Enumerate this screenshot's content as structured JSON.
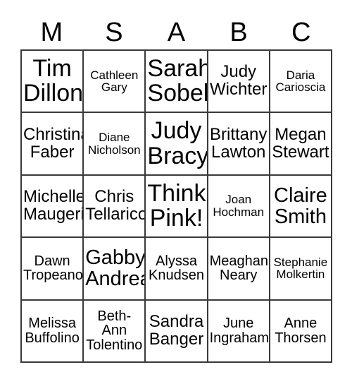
{
  "card": {
    "title_letters": [
      "M",
      "S",
      "A",
      "B",
      "C"
    ],
    "columns": 5,
    "rows": 5,
    "grid_color": "#3a3a3a",
    "background_color": "#ffffff",
    "text_color": "#000000",
    "free_space_label": "Think Pink!",
    "free_space_position": {
      "row": 3,
      "column": 3
    }
  },
  "cells": [
    {
      "r": 1,
      "c": 1,
      "text": "Tim Dillon",
      "size": "xl"
    },
    {
      "r": 1,
      "c": 2,
      "text": "Cathleen Gary",
      "size": "xs"
    },
    {
      "r": 1,
      "c": 3,
      "text": "Sarah Sobel",
      "size": "xl"
    },
    {
      "r": 1,
      "c": 4,
      "text": "Judy Wichter",
      "size": "md"
    },
    {
      "r": 1,
      "c": 5,
      "text": "Daria Carioscia",
      "size": "xs"
    },
    {
      "r": 2,
      "c": 1,
      "text": "Christina Faber",
      "size": "md"
    },
    {
      "r": 2,
      "c": 2,
      "text": "Diane Nicholson",
      "size": "xs"
    },
    {
      "r": 2,
      "c": 3,
      "text": "Judy Bracy",
      "size": "xl"
    },
    {
      "r": 2,
      "c": 4,
      "text": "Brittany Lawton",
      "size": "md"
    },
    {
      "r": 2,
      "c": 5,
      "text": "Megan Stewart",
      "size": "md"
    },
    {
      "r": 3,
      "c": 1,
      "text": "Michelle Maugeri",
      "size": "md"
    },
    {
      "r": 3,
      "c": 2,
      "text": "Chris Tellarico",
      "size": "md"
    },
    {
      "r": 3,
      "c": 3,
      "text": "Think Pink!",
      "size": "xl"
    },
    {
      "r": 3,
      "c": 4,
      "text": "Joan Hochman",
      "size": "xs"
    },
    {
      "r": 3,
      "c": 5,
      "text": "Claire Smith",
      "size": "lg"
    },
    {
      "r": 4,
      "c": 1,
      "text": "Dawn Tropeano",
      "size": "sm"
    },
    {
      "r": 4,
      "c": 2,
      "text": "Gabby Andrea",
      "size": "lg"
    },
    {
      "r": 4,
      "c": 3,
      "text": "Alyssa Knudsen",
      "size": "sm"
    },
    {
      "r": 4,
      "c": 4,
      "text": "Meaghan Neary",
      "size": "sm"
    },
    {
      "r": 4,
      "c": 5,
      "text": "Stephanie Molkertin",
      "size": "xs"
    },
    {
      "r": 5,
      "c": 1,
      "text": "Melissa Buffolino",
      "size": "sm"
    },
    {
      "r": 5,
      "c": 2,
      "text": "Beth-Ann Tolentino",
      "size": "sm"
    },
    {
      "r": 5,
      "c": 3,
      "text": "Sandra Banger",
      "size": "md"
    },
    {
      "r": 5,
      "c": 4,
      "text": "June Ingraham",
      "size": "sm"
    },
    {
      "r": 5,
      "c": 5,
      "text": "Anne Thorsen",
      "size": "sm"
    }
  ]
}
